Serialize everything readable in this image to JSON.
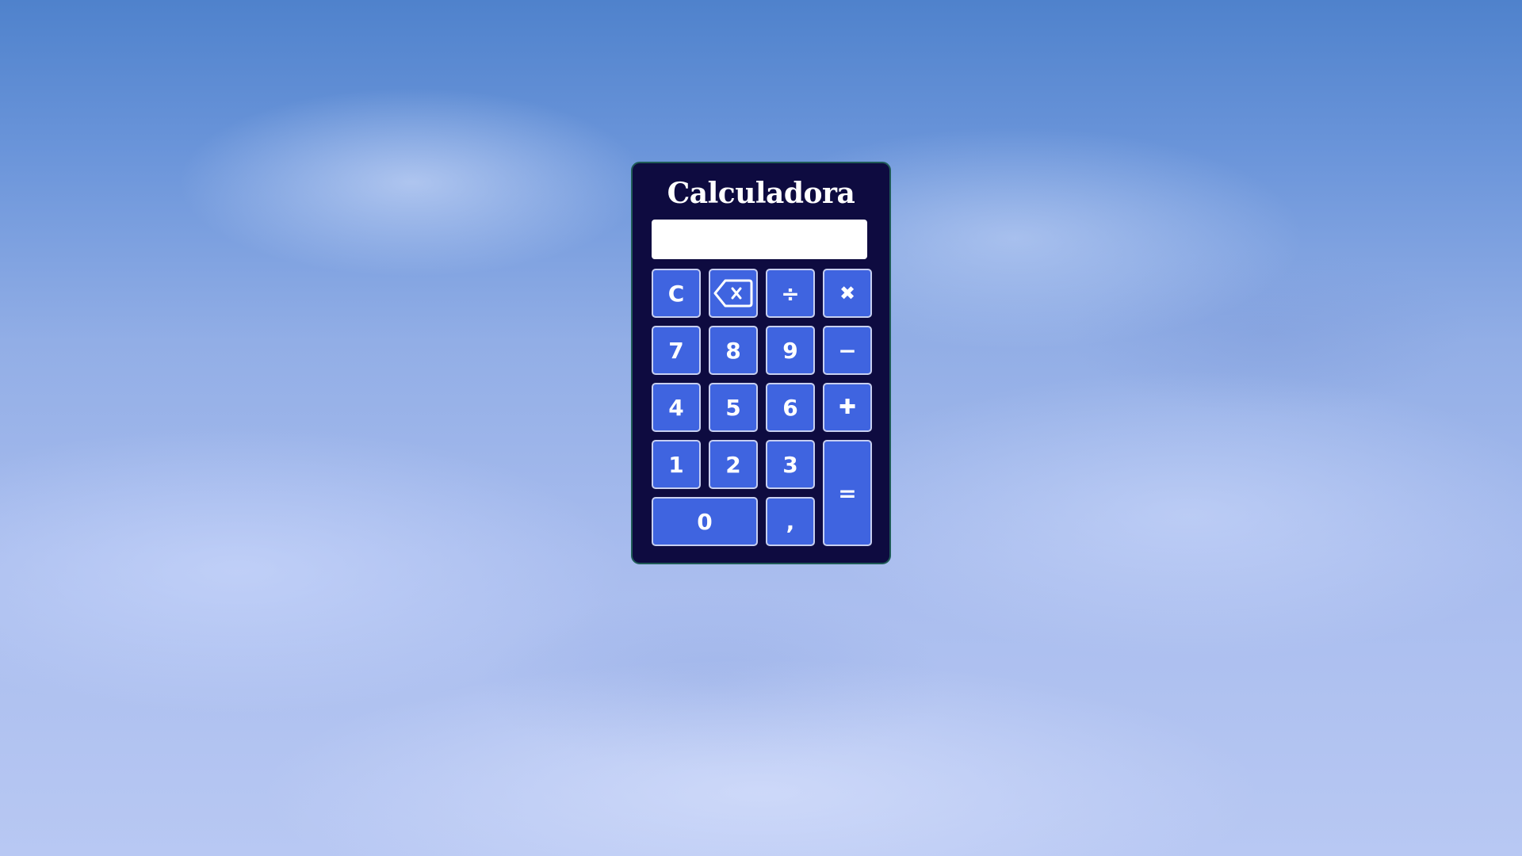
{
  "calculator": {
    "title": "Calculadora",
    "display_value": "",
    "keys": {
      "clear": "C",
      "backspace_icon": "backspace-icon",
      "divide": "÷",
      "multiply": "✖",
      "seven": "7",
      "eight": "8",
      "nine": "9",
      "minus": "−",
      "four": "4",
      "five": "5",
      "six": "6",
      "plus": "✚",
      "one": "1",
      "two": "2",
      "three": "3",
      "equals": "=",
      "zero": "0",
      "comma": ","
    }
  },
  "colors": {
    "panel": "#0e0b40",
    "key": "#3f64e0",
    "key_border": "#c7cff0",
    "display": "#ffffff"
  }
}
